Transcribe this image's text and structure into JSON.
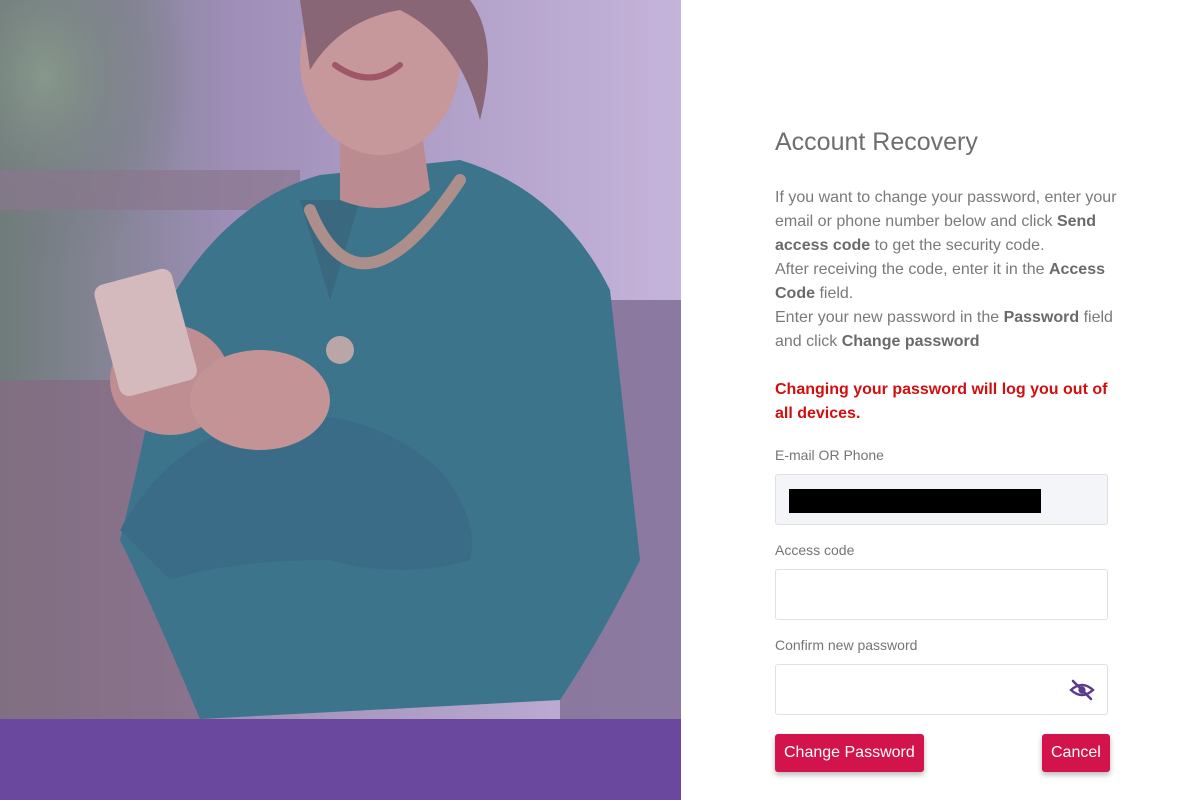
{
  "form": {
    "title": "Account Recovery",
    "instructions": [
      [
        "If you want to change your password, enter your email or phone number below and click ",
        "Send access code",
        " to get the security code."
      ],
      [
        "After receiving the code, enter it in the ",
        "Access Code",
        " field."
      ],
      [
        "Enter your new password in the ",
        "Password",
        " field and click ",
        "Change password"
      ]
    ],
    "warning": "Changing your password will log you out of all devices.",
    "email_label": "E-mail OR Phone",
    "access_code_label": "Access code",
    "access_code_value": "",
    "confirm_password_label": "Confirm new password",
    "confirm_password_value": "",
    "change_password_button": "Change Password",
    "cancel_button": "Cancel"
  },
  "icons": {
    "password_toggle": "eye-slash-icon"
  },
  "colors": {
    "accent": "#d3134b",
    "warning": "#d20f0f",
    "hero_overlay": "#6a489e",
    "eye_icon": "#5b3a8c"
  }
}
